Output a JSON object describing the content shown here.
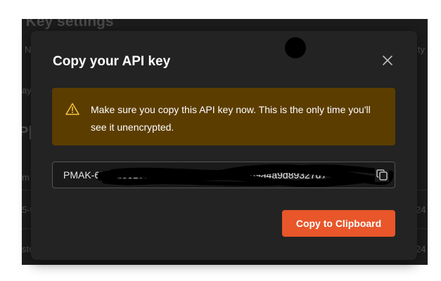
{
  "background": {
    "heading_fragment": "I Key settings",
    "frag_top_left": "N",
    "frag_top_right": "ity",
    "frag_mid_left": "ay",
    "frag_big_left": "P|",
    "frag_left_1": "m",
    "frag_left_2": "5-t",
    "frag_left_3": "ste",
    "frag_right_1": "24",
    "frag_right_2": "24"
  },
  "modal": {
    "title": "Copy your API key",
    "close_icon": "close-icon",
    "warning": {
      "icon": "warning-triangle-icon",
      "text": "Make sure you copy this API key now. This is the only time you'll see it unencrypted."
    },
    "api_key": {
      "value": "PMAK-67631561c56888000191160e-35b769a4a9d89327d1",
      "copy_icon": "copy-icon"
    },
    "copy_button_label": "Copy to Clipboard"
  },
  "colors": {
    "modal_bg": "#232323",
    "page_bg": "#1c1c1c",
    "warning_bg": "#5c3d00",
    "warning_icon": "#f5c542",
    "accent": "#e8562a",
    "text": "#ffffff"
  }
}
